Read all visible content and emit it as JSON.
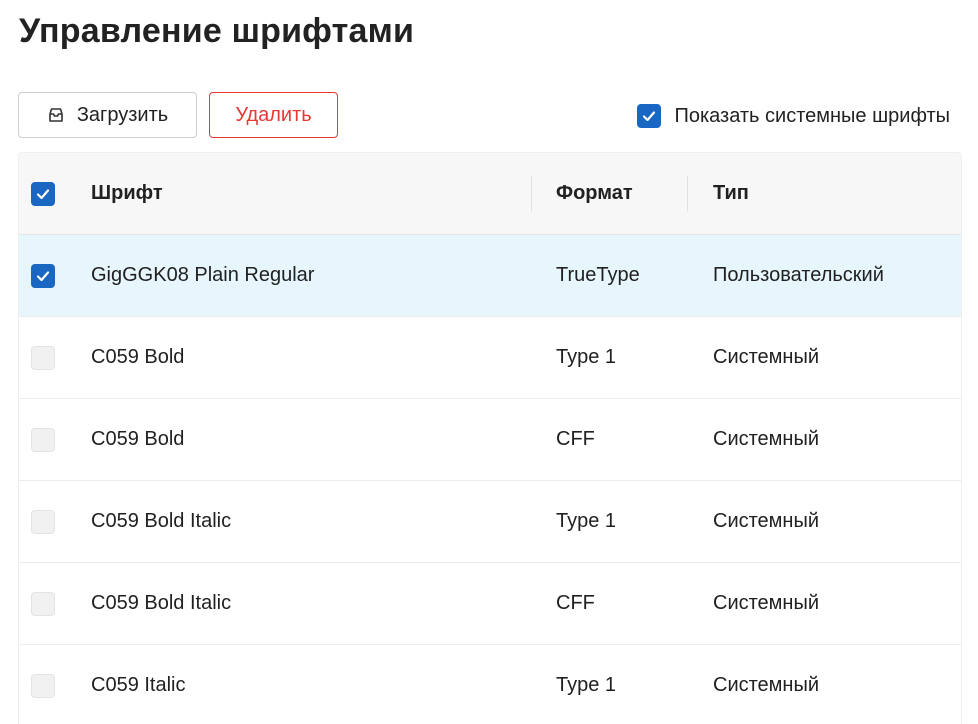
{
  "page": {
    "title": "Управление шрифтами"
  },
  "toolbar": {
    "upload_label": "Загрузить",
    "upload_icon": "upload-tray-icon",
    "delete_label": "Удалить",
    "show_system_label": "Показать системные шрифты",
    "show_system_checked": true
  },
  "table": {
    "columns": {
      "name": "Шрифт",
      "format": "Формат",
      "type": "Тип"
    },
    "select_all_checked": true,
    "rows": [
      {
        "name": "GigGGK08 Plain Regular",
        "format": "TrueType",
        "type": "Пользовательский",
        "checked": true
      },
      {
        "name": "C059 Bold",
        "format": "Type 1",
        "type": "Системный",
        "checked": false
      },
      {
        "name": "C059 Bold",
        "format": "CFF",
        "type": "Системный",
        "checked": false
      },
      {
        "name": "C059 Bold Italic",
        "format": "Type 1",
        "type": "Системный",
        "checked": false
      },
      {
        "name": "C059 Bold Italic",
        "format": "CFF",
        "type": "Системный",
        "checked": false
      },
      {
        "name": "C059 Italic",
        "format": "Type 1",
        "type": "Системный",
        "checked": false
      }
    ]
  },
  "colors": {
    "accent": "#1967c2",
    "danger": "#e53935",
    "selected_row": "#e6f6fc",
    "header_bg": "#f7f7f7"
  }
}
